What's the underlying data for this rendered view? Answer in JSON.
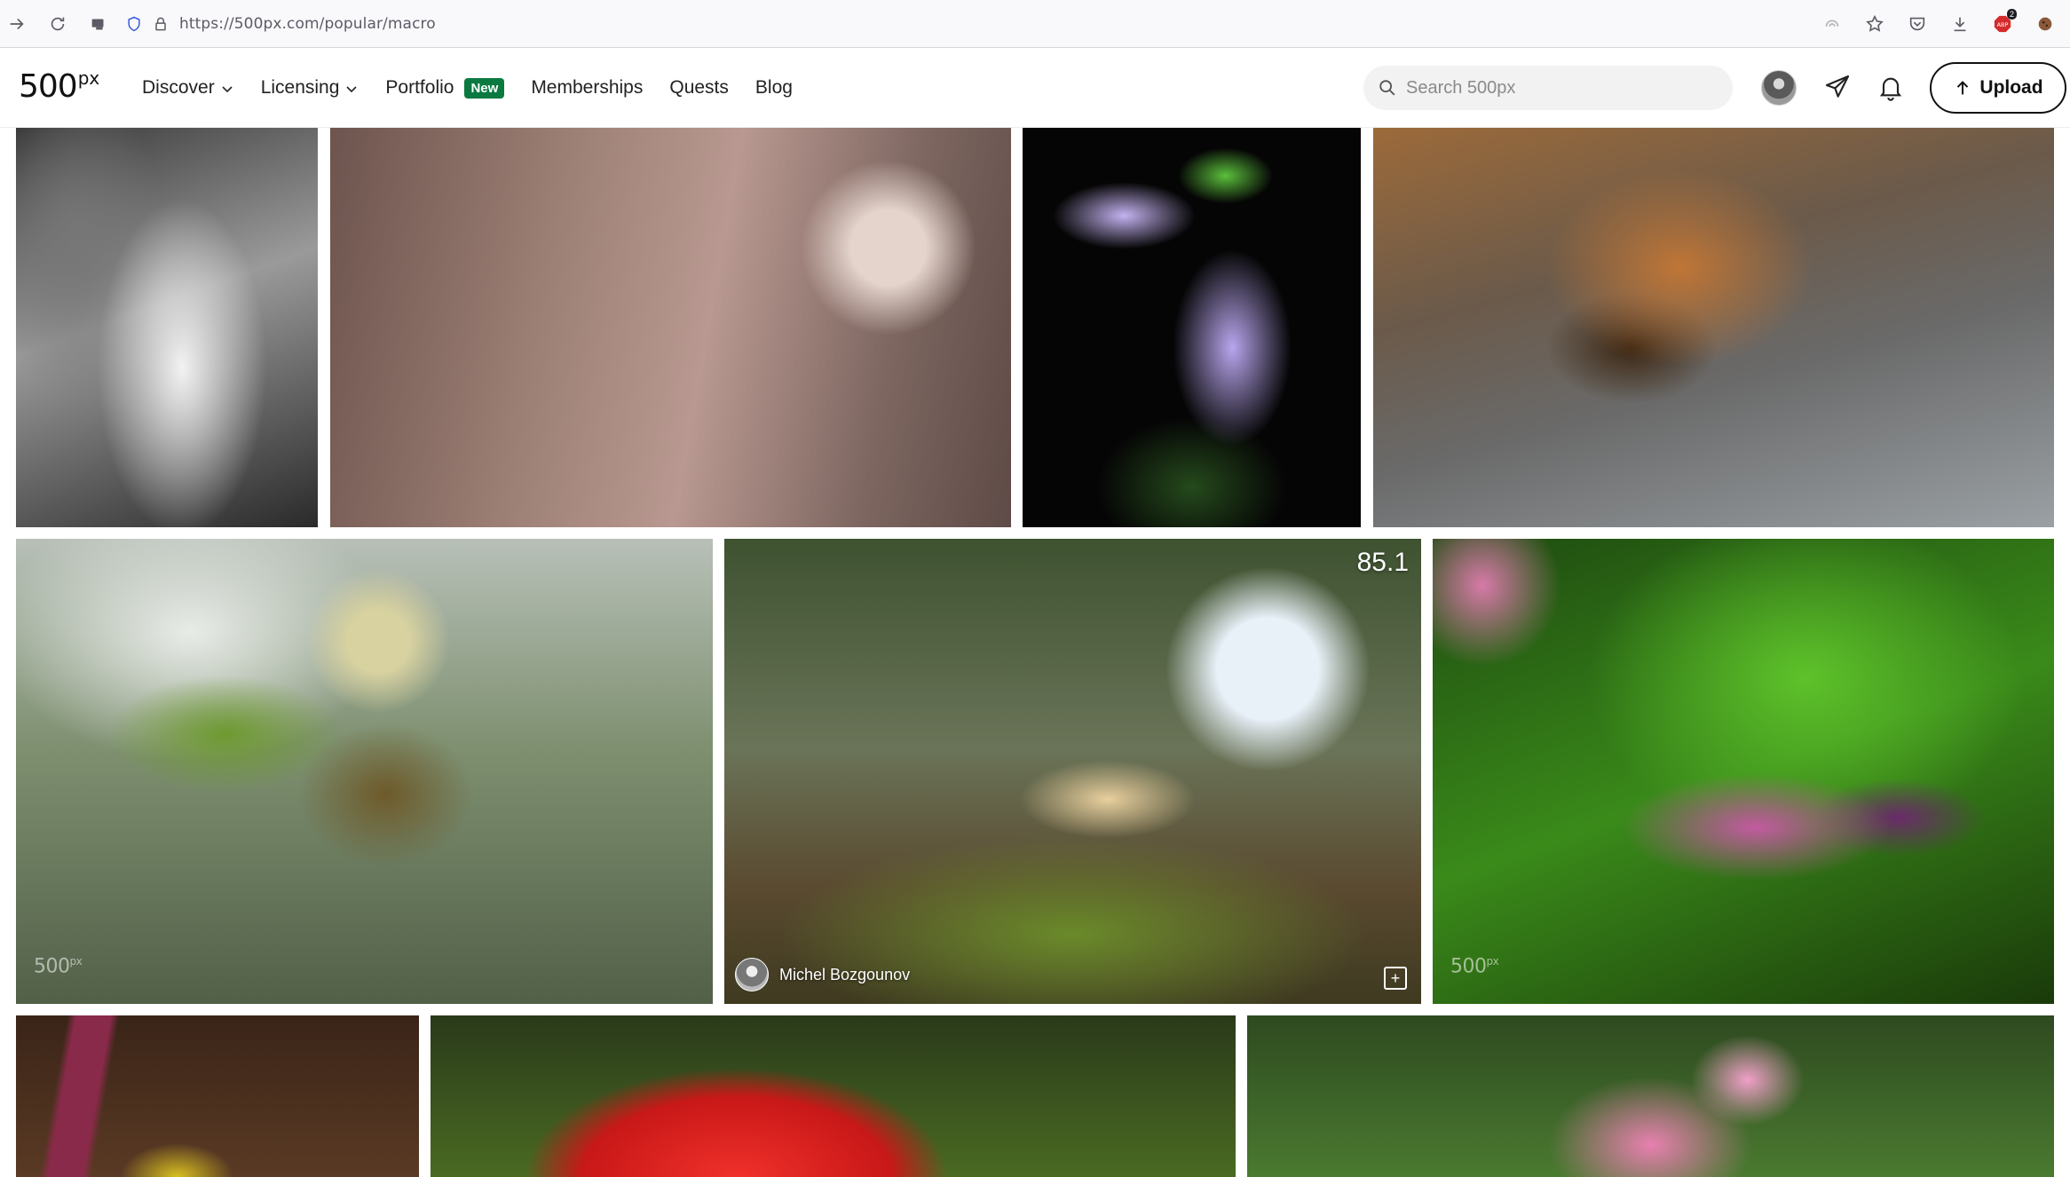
{
  "browser": {
    "url": "https://500px.com/popular/macro",
    "extension_badge": "2"
  },
  "header": {
    "logo_main": "500",
    "logo_sup": "px",
    "nav": [
      {
        "label": "Discover",
        "dropdown": true
      },
      {
        "label": "Licensing",
        "dropdown": true
      },
      {
        "label": "Portfolio",
        "dropdown": false,
        "badge": "New"
      },
      {
        "label": "Memberships",
        "dropdown": false
      },
      {
        "label": "Quests",
        "dropdown": false
      },
      {
        "label": "Blog",
        "dropdown": false
      }
    ],
    "search_placeholder": "Search 500px",
    "upload_label": "Upload",
    "badge_color": "#0b7a40"
  },
  "photos": {
    "watermark_main": "500",
    "watermark_sup": "px",
    "featured": {
      "pulse": "85.1",
      "author": "Michel Bozgounov"
    }
  }
}
